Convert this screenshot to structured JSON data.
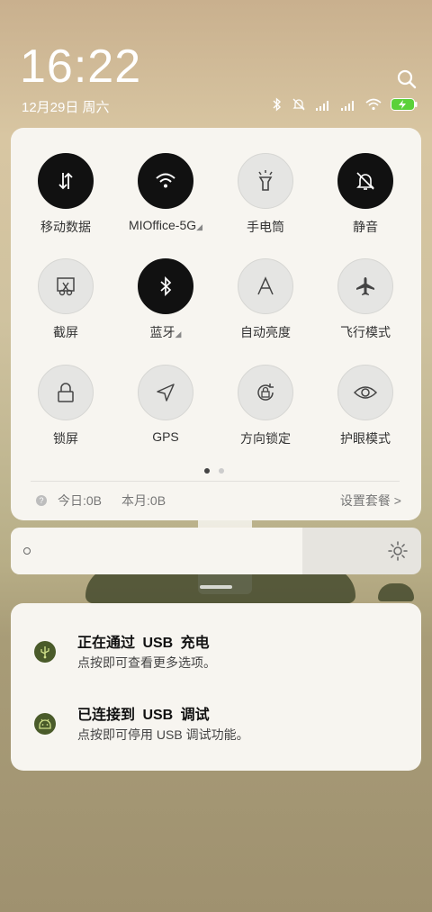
{
  "status_bar": {
    "time": "16:22",
    "date": "12月29日 周六"
  },
  "quick_settings": {
    "tiles": [
      {
        "label": "移动数据",
        "icon": "mobile-data-icon",
        "on": true
      },
      {
        "label": "MIOffice-5G",
        "icon": "wifi-icon",
        "on": true,
        "expandable": true
      },
      {
        "label": "手电筒",
        "icon": "flashlight-icon",
        "on": false
      },
      {
        "label": "静音",
        "icon": "mute-icon",
        "on": true
      },
      {
        "label": "截屏",
        "icon": "screenshot-icon",
        "on": false
      },
      {
        "label": "蓝牙",
        "icon": "bluetooth-icon",
        "on": true,
        "expandable": true
      },
      {
        "label": "自动亮度",
        "icon": "auto-brightness-icon",
        "on": false
      },
      {
        "label": "飞行模式",
        "icon": "airplane-icon",
        "on": false
      },
      {
        "label": "锁屏",
        "icon": "lock-icon",
        "on": false
      },
      {
        "label": "GPS",
        "icon": "gps-icon",
        "on": false
      },
      {
        "label": "方向锁定",
        "icon": "rotation-lock-icon",
        "on": false
      },
      {
        "label": "护眼模式",
        "icon": "eye-icon",
        "on": false
      }
    ],
    "page_count": 2,
    "current_page": 1,
    "data_usage": {
      "help": "?",
      "today": "今日:0B",
      "month": "本月:0B",
      "plan_link": "设置套餐 >"
    }
  },
  "brightness": {
    "level": 0.71
  },
  "notifications": [
    {
      "title": "正在通过 USB 充电",
      "body": "点按即可查看更多选项。",
      "icon": "usb-icon"
    },
    {
      "title": "已连接到 USB 调试",
      "body": "点按即可停用 USB 调试功能。",
      "icon": "android-debug-icon"
    }
  ],
  "colors": {
    "panel": "#f7f5f0",
    "tile_on": "#111111",
    "tile_off": "#e5e5e3",
    "battery": "#5bd13a",
    "notif_icon": "#4a5b2a"
  }
}
